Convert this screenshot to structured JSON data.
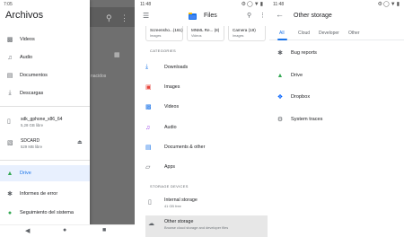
{
  "panel_drawer": {
    "status_time": "7:05",
    "title": "Archivos",
    "items": [
      {
        "label": "Videos",
        "icon": "video-icon"
      },
      {
        "label": "Audio",
        "icon": "music-icon"
      },
      {
        "label": "Documentos",
        "icon": "document-icon"
      },
      {
        "label": "Descargas",
        "icon": "download-icon"
      }
    ],
    "storage": [
      {
        "name": "sdk_gphone_x86_64",
        "free": "5,28 GB libre",
        "icon": "phone-icon"
      },
      {
        "name": "SDCARD",
        "free": "529 MB libre",
        "icon": "sdcard-icon"
      }
    ],
    "bottom_items": [
      {
        "label": "Drive",
        "icon": "drive-icon",
        "active": true
      },
      {
        "label": "Informes de error",
        "icon": "bug-icon"
      },
      {
        "label": "Seguimiento del sistema",
        "icon": "system-trace-icon"
      }
    ],
    "background_text": "nacidos"
  },
  "panel_files": {
    "status_time": "11:48",
    "title": "Files",
    "recent": [
      {
        "name": "Screensho...(161)",
        "kind": "Images"
      },
      {
        "name": "MNML Re... (8)",
        "kind": "Videos"
      },
      {
        "name": "Camera (19)",
        "kind": "Images"
      }
    ],
    "categories_header": "CATEGORIES",
    "categories": [
      {
        "label": "Downloads",
        "icon": "download-icon",
        "color": "#1a73e8"
      },
      {
        "label": "Images",
        "icon": "image-icon",
        "color": "#e8453c"
      },
      {
        "label": "Videos",
        "icon": "video-icon",
        "color": "#1a73e8"
      },
      {
        "label": "Audio",
        "icon": "music-icon",
        "color": "#9334e6"
      },
      {
        "label": "Documents & other",
        "icon": "document-icon",
        "color": "#1a73e8"
      },
      {
        "label": "Apps",
        "icon": "android-icon",
        "color": "#5f6368"
      }
    ],
    "storage_header": "STORAGE DEVICES",
    "storage": [
      {
        "name": "Internal storage",
        "sub": "41 GB free",
        "icon": "phone-icon"
      },
      {
        "name": "Other storage",
        "sub": "Browse cloud storage and developer files",
        "icon": "cloud-icon"
      }
    ]
  },
  "panel_other": {
    "status_time": "11:48",
    "title": "Other storage",
    "tabs": [
      "All",
      "Cloud",
      "Developer",
      "Other"
    ],
    "active_tab": "All",
    "items": [
      {
        "label": "Bug reports",
        "icon": "bug-icon"
      },
      {
        "label": "Drive",
        "icon": "drive-icon"
      },
      {
        "label": "Dropbox",
        "icon": "dropbox-icon"
      },
      {
        "label": "System traces",
        "icon": "system-trace-icon"
      }
    ]
  },
  "colors": {
    "accent": "#1a73e8",
    "active_bg": "#e8f0fe",
    "highlight_bg": "#e7e7e7"
  }
}
